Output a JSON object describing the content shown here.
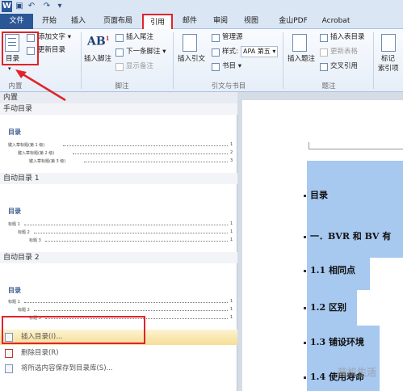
{
  "tabs": {
    "file": "文件",
    "items": [
      "开始",
      "插入",
      "页面布局",
      "引用",
      "邮件",
      "审阅",
      "视图",
      "金山PDF",
      "Acrobat"
    ]
  },
  "ribbon": {
    "toc_button": "目录",
    "add_text": "添加文字",
    "update_toc": "更新目录",
    "insert_footnote": "插入脚注",
    "insert_endnote": "插入尾注",
    "next_footnote": "下一条脚注",
    "show_notes": "显示备注",
    "footnote_group": "脚注",
    "insert_citation": "插入引文",
    "manage_sources": "管理源",
    "style_label": "样式:",
    "style_value": "APA 第五",
    "bibliography": "书目",
    "citation_group": "引文与书目",
    "insert_caption": "插入题注",
    "insert_table_of_figures": "插入表目录",
    "update_table": "更新表格",
    "cross_reference": "交叉引用",
    "caption_group": "题注",
    "mark_entry_line1": "标记",
    "mark_entry_line2": "索引项",
    "toc_group": "内置"
  },
  "dropdown": {
    "header": "内置",
    "manual_toc": {
      "label": "手动目录",
      "title": "目录",
      "lines": [
        "键入章标题(第 1 级)",
        "键入章标题(第 2 级)",
        "键入章标题(第 3 级)"
      ],
      "pages": [
        "1",
        "2",
        "3"
      ]
    },
    "auto_toc_1": {
      "label": "自动目录 1",
      "title": "目录",
      "lines": [
        "标题 1",
        "标题 2",
        "标题 3"
      ],
      "pages": [
        "1",
        "1",
        "1"
      ]
    },
    "auto_toc_2": {
      "label": "自动目录 2",
      "title": "目录",
      "lines": [
        "标题 1",
        "标题 2",
        "标题 3"
      ],
      "pages": [
        "1",
        "1",
        "1"
      ]
    },
    "menu": {
      "insert_toc": "插入目录(I)...",
      "delete_toc": "删除目录(R)",
      "save_selection": "将所选内容保存到目录库(S)..."
    }
  },
  "document": {
    "lines": [
      "目录",
      "一．BVR 和 BV 有",
      "1.1 相同点",
      "1.2 区别",
      "1.3 铺设环境",
      "1.4 使用寿命"
    ]
  },
  "watermark": "装机生活",
  "colors": {
    "file_tab": "#2b5797",
    "highlight_red": "#e0242a",
    "selection": "#a7c8ef"
  }
}
